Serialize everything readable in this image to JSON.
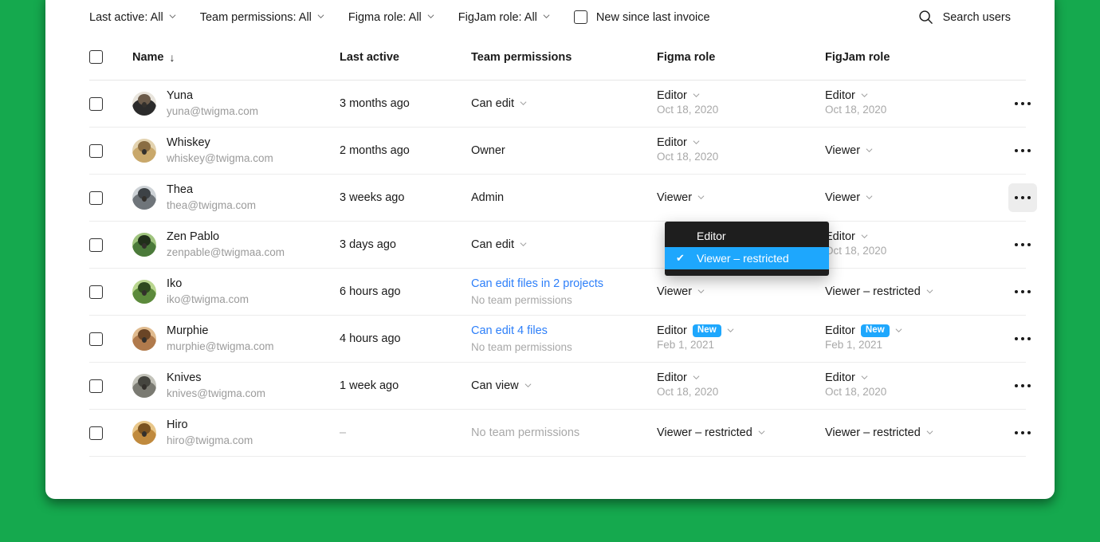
{
  "theme": {
    "background": "#15a94e",
    "accent": "#1ea7fd",
    "link": "#2d7ff9",
    "menu_bg": "#1e1e1e"
  },
  "filters": [
    {
      "label": "Last active: All",
      "icon": "chevron-down-icon"
    },
    {
      "label": "Team permissions: All",
      "icon": "chevron-down-icon"
    },
    {
      "label": "Figma role: All",
      "icon": "chevron-down-icon"
    },
    {
      "label": "FigJam role: All",
      "icon": "chevron-down-icon"
    }
  ],
  "new_since_invoice": {
    "label": "New since last invoice",
    "checked": false
  },
  "search": {
    "label": "Search users",
    "icon": "search-icon"
  },
  "table": {
    "columns": {
      "name": "Name",
      "sort_indicator": "↓",
      "last_active": "Last active",
      "team_permissions": "Team permissions",
      "figma_role": "Figma role",
      "figjam_role": "FigJam role"
    },
    "rows": [
      {
        "name": "Yuna",
        "email": "yuna@twigma.com",
        "last_active": "3 months ago",
        "team_permissions": "Can edit",
        "team_has_chevron": true,
        "team_is_link": false,
        "team_sub": "",
        "figma_role": "Editor",
        "figma_date": "Oct 18, 2020",
        "figma_badge": "",
        "figjam_role": "Editor",
        "figjam_date": "Oct 18, 2020",
        "figjam_badge": "",
        "more_active": false,
        "dimmed": false
      },
      {
        "name": "Whiskey",
        "email": "whiskey@twigma.com",
        "last_active": "2 months ago",
        "team_permissions": "Owner",
        "team_has_chevron": false,
        "team_is_link": false,
        "team_sub": "",
        "figma_role": "Editor",
        "figma_date": "Oct 18, 2020",
        "figma_badge": "",
        "figjam_role": "Viewer",
        "figjam_date": "",
        "figjam_badge": "",
        "more_active": false,
        "dimmed": false
      },
      {
        "name": "Thea",
        "email": "thea@twigma.com",
        "last_active": "3 weeks ago",
        "team_permissions": "Admin",
        "team_has_chevron": false,
        "team_is_link": false,
        "team_sub": "",
        "figma_role": "Viewer",
        "figma_date": "",
        "figma_badge": "",
        "figjam_role": "Viewer",
        "figjam_date": "",
        "figjam_badge": "",
        "more_active": true,
        "dimmed": false
      },
      {
        "name": "Zen Pablo",
        "email": "zenpable@twigmaa.com",
        "last_active": "3 days ago",
        "team_permissions": "Can edit",
        "team_has_chevron": true,
        "team_is_link": false,
        "team_sub": "",
        "figma_role": "",
        "figma_date": "",
        "figma_badge": "",
        "figjam_role": "Editor",
        "figjam_date": "Oct 18, 2020",
        "figjam_badge": "",
        "more_active": false,
        "dimmed": false
      },
      {
        "name": "Iko",
        "email": "iko@twigma.com",
        "last_active": "6 hours ago",
        "team_permissions": "Can edit files in 2 projects",
        "team_has_chevron": false,
        "team_is_link": true,
        "team_sub": "No team permissions",
        "figma_role": "Viewer",
        "figma_date": "",
        "figma_badge": "",
        "figjam_role": "Viewer – restricted",
        "figjam_date": "",
        "figjam_badge": "",
        "more_active": false,
        "dimmed": false
      },
      {
        "name": "Murphie",
        "email": "murphie@twigma.com",
        "last_active": "4 hours ago",
        "team_permissions": "Can edit 4 files",
        "team_has_chevron": false,
        "team_is_link": true,
        "team_sub": "No team permissions",
        "figma_role": "Editor",
        "figma_date": "Feb 1, 2021",
        "figma_badge": "New",
        "figjam_role": "Editor",
        "figjam_date": "Feb 1, 2021",
        "figjam_badge": "New",
        "more_active": false,
        "dimmed": false
      },
      {
        "name": "Knives",
        "email": "knives@twigma.com",
        "last_active": "1 week ago",
        "team_permissions": "Can view",
        "team_has_chevron": true,
        "team_is_link": false,
        "team_sub": "",
        "figma_role": "Editor",
        "figma_date": "Oct 18, 2020",
        "figma_badge": "",
        "figjam_role": "Editor",
        "figjam_date": "Oct 18, 2020",
        "figjam_badge": "",
        "more_active": false,
        "dimmed": false
      },
      {
        "name": "Hiro",
        "email": "hiro@twigma.com",
        "last_active": "–",
        "team_permissions": "No team permissions",
        "team_has_chevron": false,
        "team_is_link": false,
        "team_sub": "",
        "figma_role": "Viewer – restricted",
        "figma_date": "",
        "figma_badge": "",
        "figjam_role": "Viewer – restricted",
        "figjam_date": "",
        "figjam_badge": "",
        "more_active": false,
        "dimmed": true
      }
    ]
  },
  "role_menu": {
    "items": [
      {
        "label": "Editor",
        "selected": false
      },
      {
        "label": "Viewer – restricted",
        "selected": true
      }
    ],
    "check_glyph": "✔"
  }
}
